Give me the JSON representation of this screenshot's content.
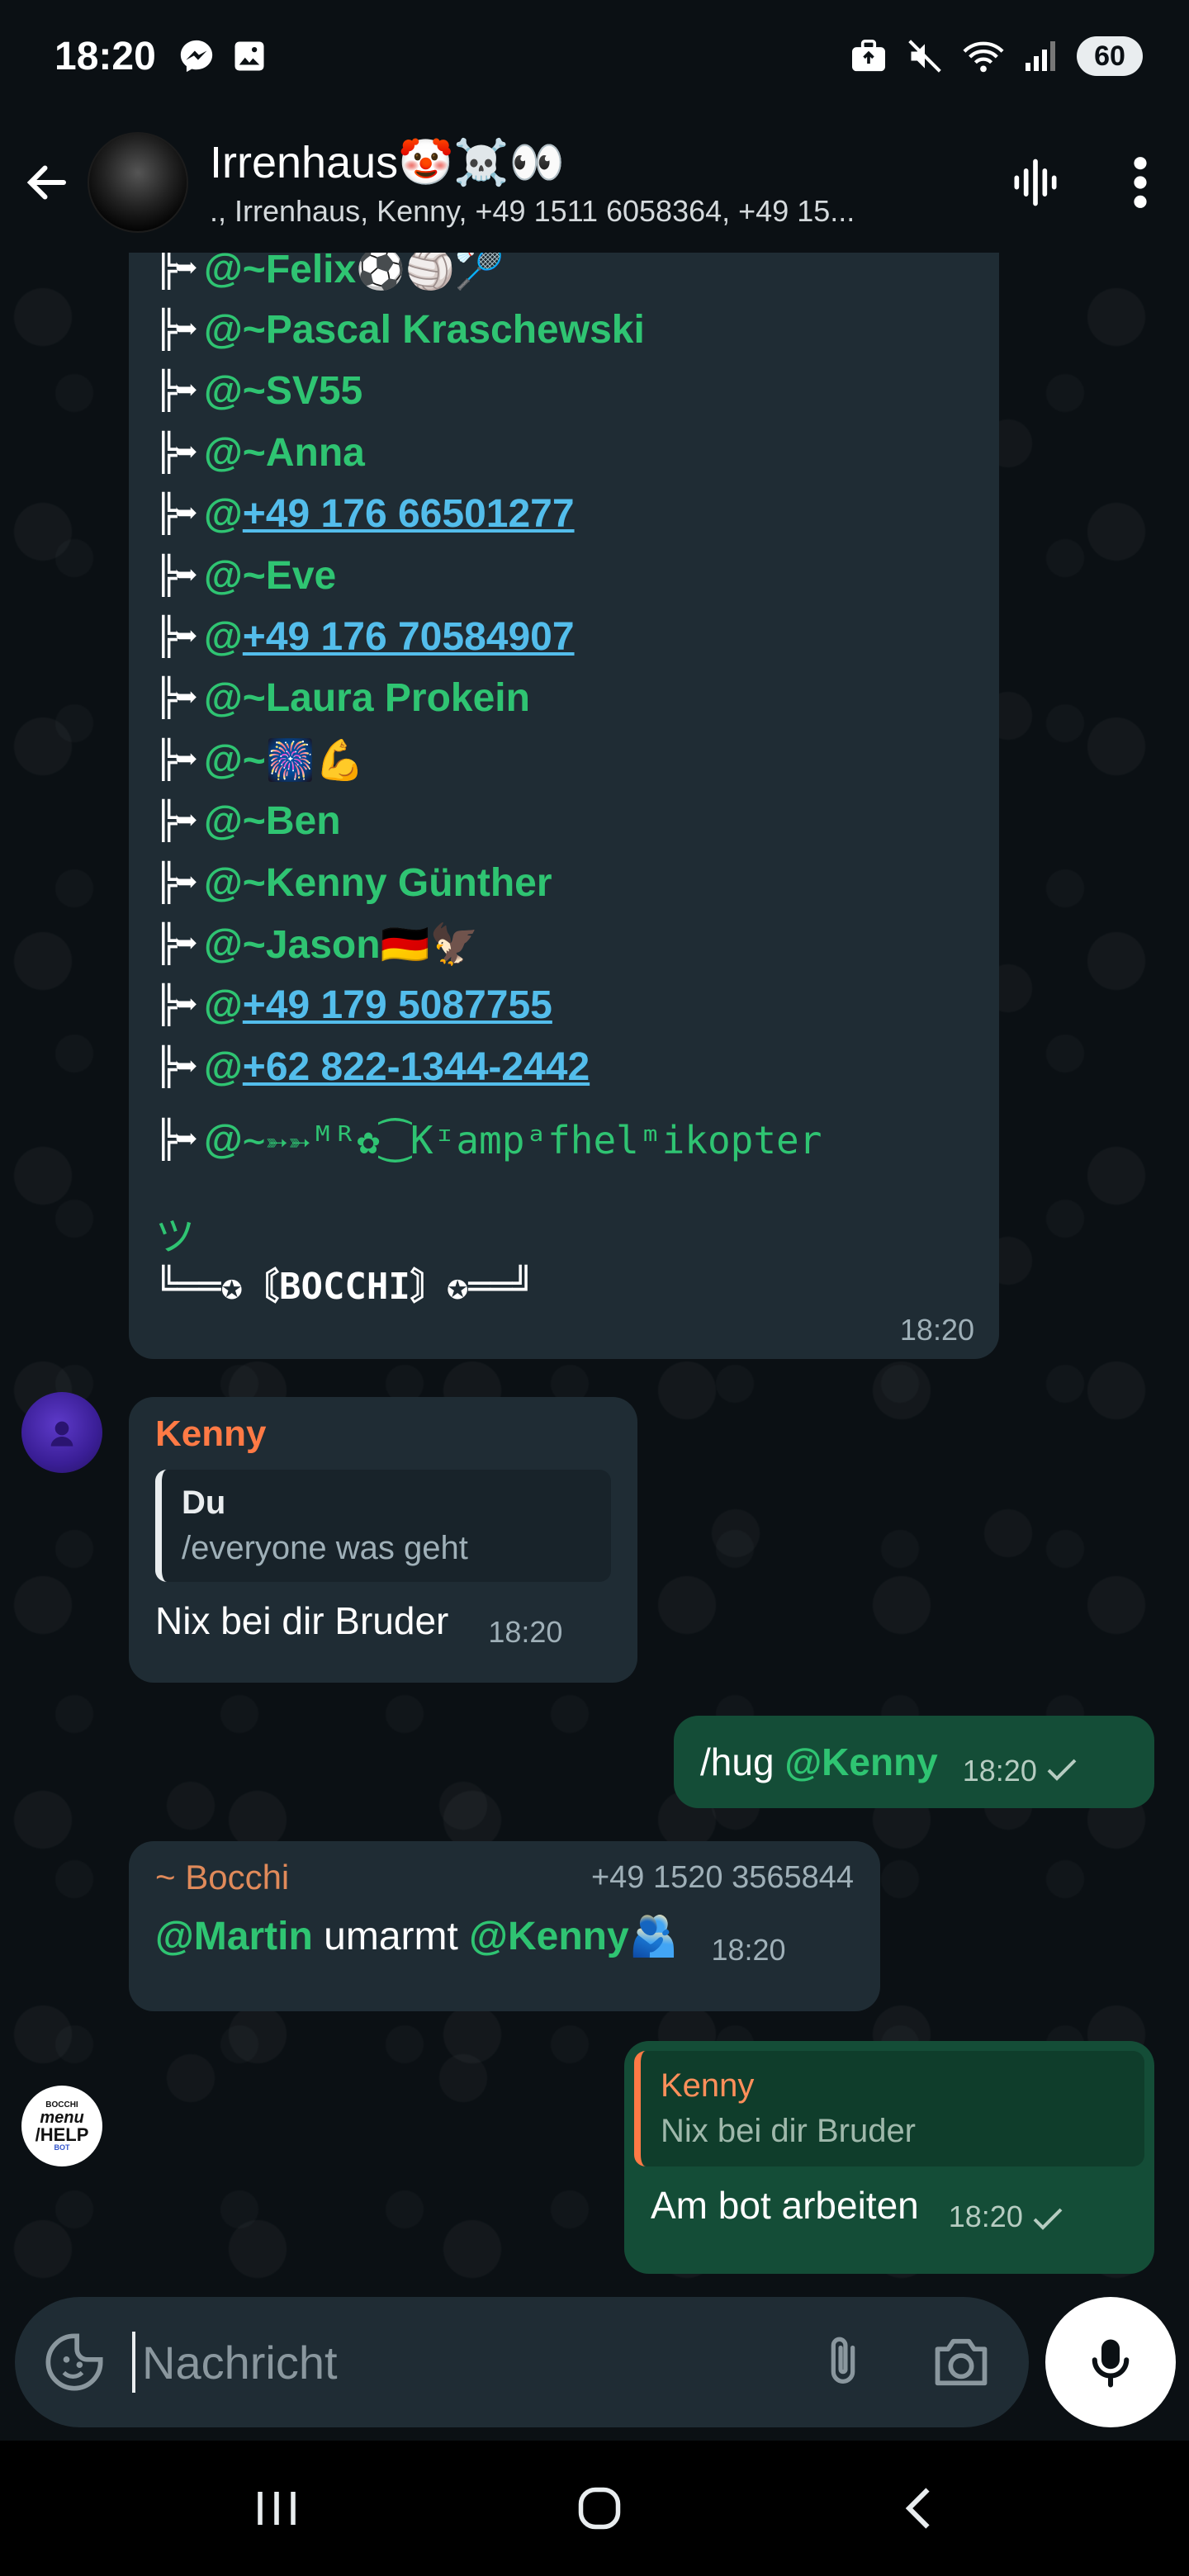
{
  "status_bar": {
    "time": "18:20",
    "battery": "60",
    "icons": [
      "messenger-icon",
      "image-icon",
      "briefcase-icon",
      "mute-icon",
      "wifi-icon",
      "signal-icon"
    ]
  },
  "header": {
    "title": "Irrenhaus🤡☠️👀",
    "subtitle": "., Irrenhaus, Kenny, +49 1511 6058364, +49 15..."
  },
  "mention_list": {
    "rows": [
      {
        "tree": "╠➥",
        "at": "@",
        "name": "~Felix⚽🏐🏸",
        "type": "name"
      },
      {
        "tree": "╠➥",
        "at": "@",
        "name": "~Pascal Kraschewski",
        "type": "name"
      },
      {
        "tree": "╠➥",
        "at": "@",
        "name": "~SV55",
        "type": "name"
      },
      {
        "tree": "╠➥",
        "at": "@",
        "name": "~Anna",
        "type": "name"
      },
      {
        "tree": "╠➥",
        "at": "@",
        "name": "+49 176 66501277",
        "type": "phone"
      },
      {
        "tree": "╠➥",
        "at": "@",
        "name": "~Eve",
        "type": "name"
      },
      {
        "tree": "╠➥",
        "at": "@",
        "name": "+49 176 70584907",
        "type": "phone"
      },
      {
        "tree": "╠➥",
        "at": "@",
        "name": "~Laura Prokein",
        "type": "name"
      },
      {
        "tree": "╠➥",
        "at": "@",
        "name": "~🎆💪",
        "type": "name"
      },
      {
        "tree": "╠➥",
        "at": "@",
        "name": "~Ben",
        "type": "name"
      },
      {
        "tree": "╠➥",
        "at": "@",
        "name": "~Kenny Günther",
        "type": "name"
      },
      {
        "tree": "╠➥",
        "at": "@",
        "name": "~Jason🇩🇪🦅",
        "type": "name"
      },
      {
        "tree": "╠➥",
        "at": "@",
        "name": "+49 179 5087755",
        "type": "phone"
      },
      {
        "tree": "╠➥",
        "at": "@",
        "name": "+62 822-1344-2442",
        "type": "phone"
      }
    ],
    "last_row": {
      "tree": "╠➥",
      "at": "@",
      "name": "~➳➳ᴹᴿ✿⁐Kᶦampᵃfhelᵐikopter"
    },
    "tsu": "ツ",
    "footer": "╚══✪〘BOCCHI〙✪══╝",
    "time": "18:20"
  },
  "messages": [
    {
      "sender": "Kenny",
      "quote_name": "Du",
      "quote_text": "/everyone was geht",
      "text": "Nix bei dir Bruder",
      "time": "18:20"
    },
    {
      "cmd": "/hug ",
      "mention": "@Kenny",
      "time": "18:20"
    },
    {
      "sender": "~ Bocchi",
      "phone": "+49 1520 3565844",
      "mention1": "@Martin",
      "mid": " umarmt ",
      "mention2": "@Kenny",
      "emoji": "🫂",
      "time": "18:20"
    },
    {
      "quote_name": "Kenny",
      "quote_text": "Nix bei dir Bruder",
      "text": "Am bot arbeiten",
      "time": "18:20"
    }
  ],
  "bocchi_avatar": {
    "top": "BOCCHI",
    "mid": "menu",
    "big": "/HELP",
    "bot": "BOT"
  },
  "input": {
    "placeholder": "Nachricht"
  }
}
